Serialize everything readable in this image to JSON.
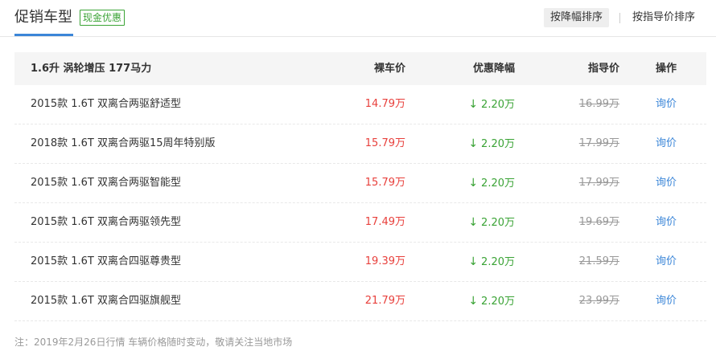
{
  "header": {
    "title": "促销车型",
    "badge": "现金优惠",
    "sort_buttons": [
      "按降幅排序",
      "按指导价排序"
    ]
  },
  "table": {
    "headers": {
      "name": "1.6升 涡轮增压 177马力",
      "price": "裸车价",
      "discount": "优惠降幅",
      "guide": "指导价",
      "op": "操作"
    },
    "rows": [
      {
        "name": "2015款 1.6T 双离合两驱舒适型",
        "price": "14.79万",
        "discount": "2.20万",
        "guide": "16.99万",
        "op": "询价"
      },
      {
        "name": "2018款 1.6T 双离合两驱15周年特别版",
        "price": "15.79万",
        "discount": "2.20万",
        "guide": "17.99万",
        "op": "询价"
      },
      {
        "name": "2015款 1.6T 双离合两驱智能型",
        "price": "15.79万",
        "discount": "2.20万",
        "guide": "17.99万",
        "op": "询价"
      },
      {
        "name": "2015款 1.6T 双离合两驱领先型",
        "price": "17.49万",
        "discount": "2.20万",
        "guide": "19.69万",
        "op": "询价"
      },
      {
        "name": "2015款 1.6T 双离合四驱尊贵型",
        "price": "19.39万",
        "discount": "2.20万",
        "guide": "21.59万",
        "op": "询价"
      },
      {
        "name": "2015款 1.6T 双离合四驱旗舰型",
        "price": "21.79万",
        "discount": "2.20万",
        "guide": "23.99万",
        "op": "询价"
      }
    ]
  },
  "footer": {
    "note": "注：2019年2月26日行情 车辆价格随时变动，敬请关注当地市场"
  },
  "colors": {
    "accent": "#3b86d8",
    "price": "#e8403c",
    "discount": "#3aa335"
  },
  "icons": {
    "discount": "arrow-down-icon"
  }
}
